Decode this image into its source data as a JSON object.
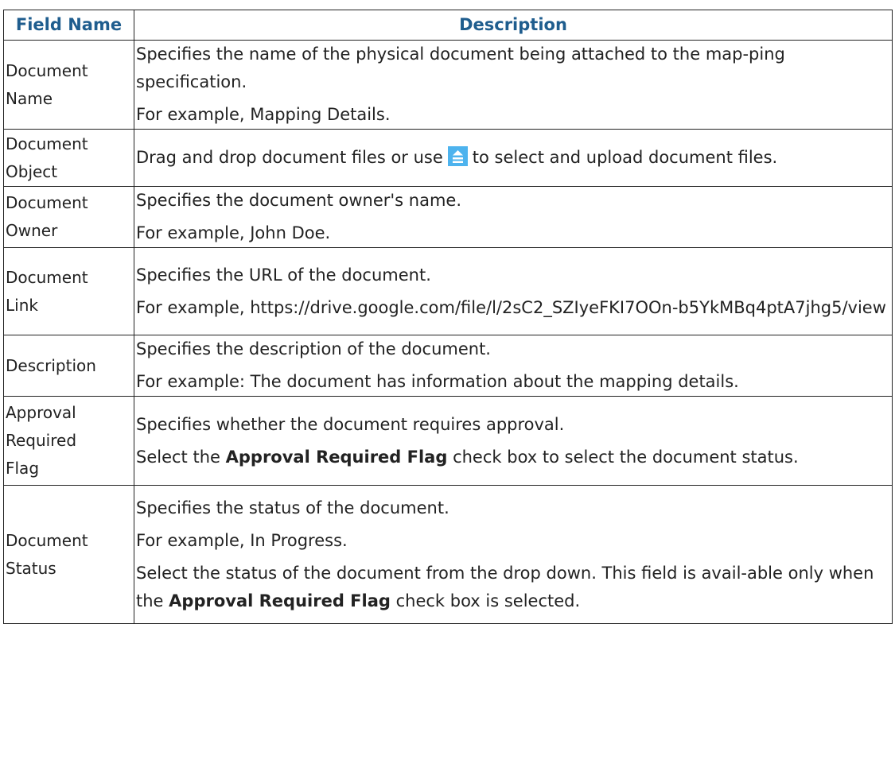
{
  "header": {
    "field_name": "Field Name",
    "description": "Description"
  },
  "colors": {
    "header_text": "#1f5d8e",
    "upload_icon_bg": "#4db3ee",
    "upload_icon_fg": "#ffffff"
  },
  "rows": [
    {
      "field": [
        "Document",
        "Name"
      ],
      "para1": "Specifies the name of the physical document being attached to the map-ping specification.",
      "para2": "For example, Mapping Details."
    },
    {
      "field": [
        "Document",
        "Object"
      ],
      "before_icon": "Drag and drop document files or use",
      "icon": "upload-icon",
      "after_icon": "to select and upload document files."
    },
    {
      "field": [
        "Document",
        "Owner"
      ],
      "para1": "Specifies the document owner's name.",
      "para2": "For example, John Doe."
    },
    {
      "field": [
        "Document",
        "Link"
      ],
      "para1": "Specifies the URL of the document.",
      "para2": "For example, https://drive.google.com/file/l/2sC2_SZIyeFKI7OOn-b5YkMBq4ptA7jhg5/view"
    },
    {
      "field": [
        "Description"
      ],
      "para1": "Specifies the description of the document.",
      "para2": "For example: The document has information about the mapping details."
    },
    {
      "field": [
        "Approval",
        "Required",
        "Flag"
      ],
      "para1": "Specifies whether the document requires approval.",
      "para2_pre": "Select the",
      "para2_bold": "Approval Required Flag",
      "para2_post": "check box to select the document status."
    },
    {
      "field": [
        "Document",
        "Status"
      ],
      "para1": "Specifies the status of the document.",
      "para2": "For example, In Progress.",
      "para3_pre": "Select the status of the document from the drop down. This field is avail-able only when the",
      "para3_bold": "Approval Required Flag",
      "para3_post": "check box is selected."
    }
  ]
}
